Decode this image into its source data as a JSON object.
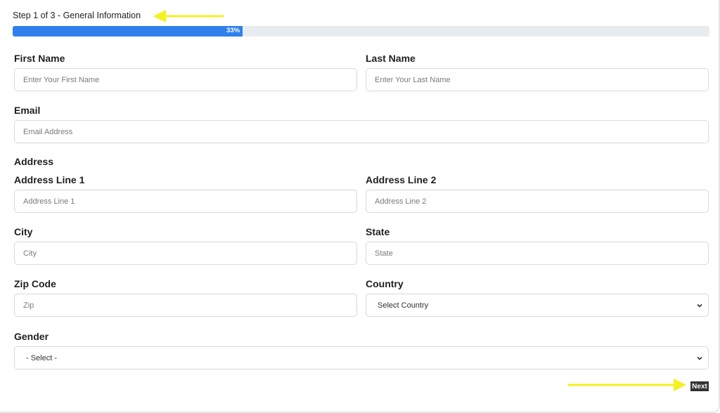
{
  "step": {
    "title": "Step 1 of 3 - General Information",
    "progress_label": "33%",
    "progress_percent": 33
  },
  "fields": {
    "first_name": {
      "label": "First Name",
      "placeholder": "Enter Your First Name"
    },
    "last_name": {
      "label": "Last Name",
      "placeholder": "Enter Your Last Name"
    },
    "email": {
      "label": "Email",
      "placeholder": "Email Address"
    },
    "address_heading": "Address",
    "address_line1": {
      "label": "Address Line 1",
      "placeholder": "Address Line 1"
    },
    "address_line2": {
      "label": "Address Line 2",
      "placeholder": "Address Line 2"
    },
    "city": {
      "label": "City",
      "placeholder": "City"
    },
    "state": {
      "label": "State",
      "placeholder": "State"
    },
    "zip": {
      "label": "Zip Code",
      "placeholder": "Zip"
    },
    "country": {
      "label": "Country",
      "selected": "Select Country"
    },
    "gender": {
      "label": "Gender",
      "selected": "- Select -"
    }
  },
  "actions": {
    "next_label": "Next"
  },
  "colors": {
    "progress": "#2f80ed",
    "annotation_arrow": "#f5f020",
    "next_button": "#333333"
  },
  "icons": {
    "select_chevron": "chevron-down-icon",
    "annotation": "arrow-annotation-icon"
  }
}
